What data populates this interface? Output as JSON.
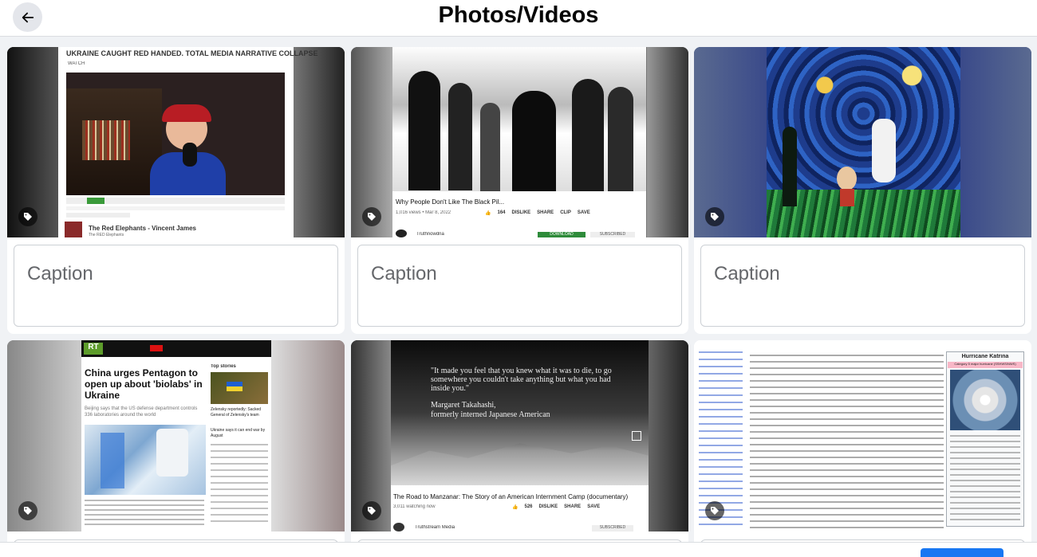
{
  "header": {
    "title": "Photos/Videos"
  },
  "caption_placeholder": "Caption",
  "items": [
    {
      "headline": "UKRAINE CAUGHT RED HANDED. TOTAL MEDIA NARRATIVE COLLAPSE",
      "watch": "WATCH",
      "channel": "The Red Elephants - Vincent James",
      "channel_sub": "The RED Elephants"
    },
    {
      "video_title": "Why People Don't Like The Black Pil...",
      "meta": "1,016 views • Mar 8, 2022",
      "likes": "164",
      "dislike": "DISLIKE",
      "share": "SHARE",
      "clip": "CLIP",
      "save": "SAVE",
      "channel": "Truthnowdna",
      "download": "DOWNLOAD",
      "subscribe": "SUBSCRIBED"
    },
    {},
    {
      "brand": "RT",
      "headline": "China urges Pentagon to open up about 'biolabs' in Ukraine",
      "subtitle": "Beijing says that the US defense department controls 336 laboratories around the world",
      "side_heading": "Top stories",
      "side_1": "Zelensky reportedly: Sacked General of Zelensky's team",
      "side_2": "Ukraine says it can end war by August"
    },
    {
      "quote": "\"It made you feel that you knew what it was to die, to go somewhere you couldn't take anything but what you had inside you.\"",
      "attribution_name": "Margaret Takahashi,",
      "attribution_role": "formerly interned Japanese American",
      "video_title": "The Road to Manzanar: The Story of an American Internment Camp (documentary)",
      "meta": "3,011 watching now",
      "likes": "526",
      "dislike": "DISLIKE",
      "share": "SHARE",
      "save": "SAVE",
      "channel": "Truthstream Media",
      "subscribe": "SUBSCRIBED"
    },
    {
      "infobox_title": "Hurricane Katrina",
      "infobox_label": "Category 5 major hurricane (SSHWS/NWS)"
    }
  ]
}
